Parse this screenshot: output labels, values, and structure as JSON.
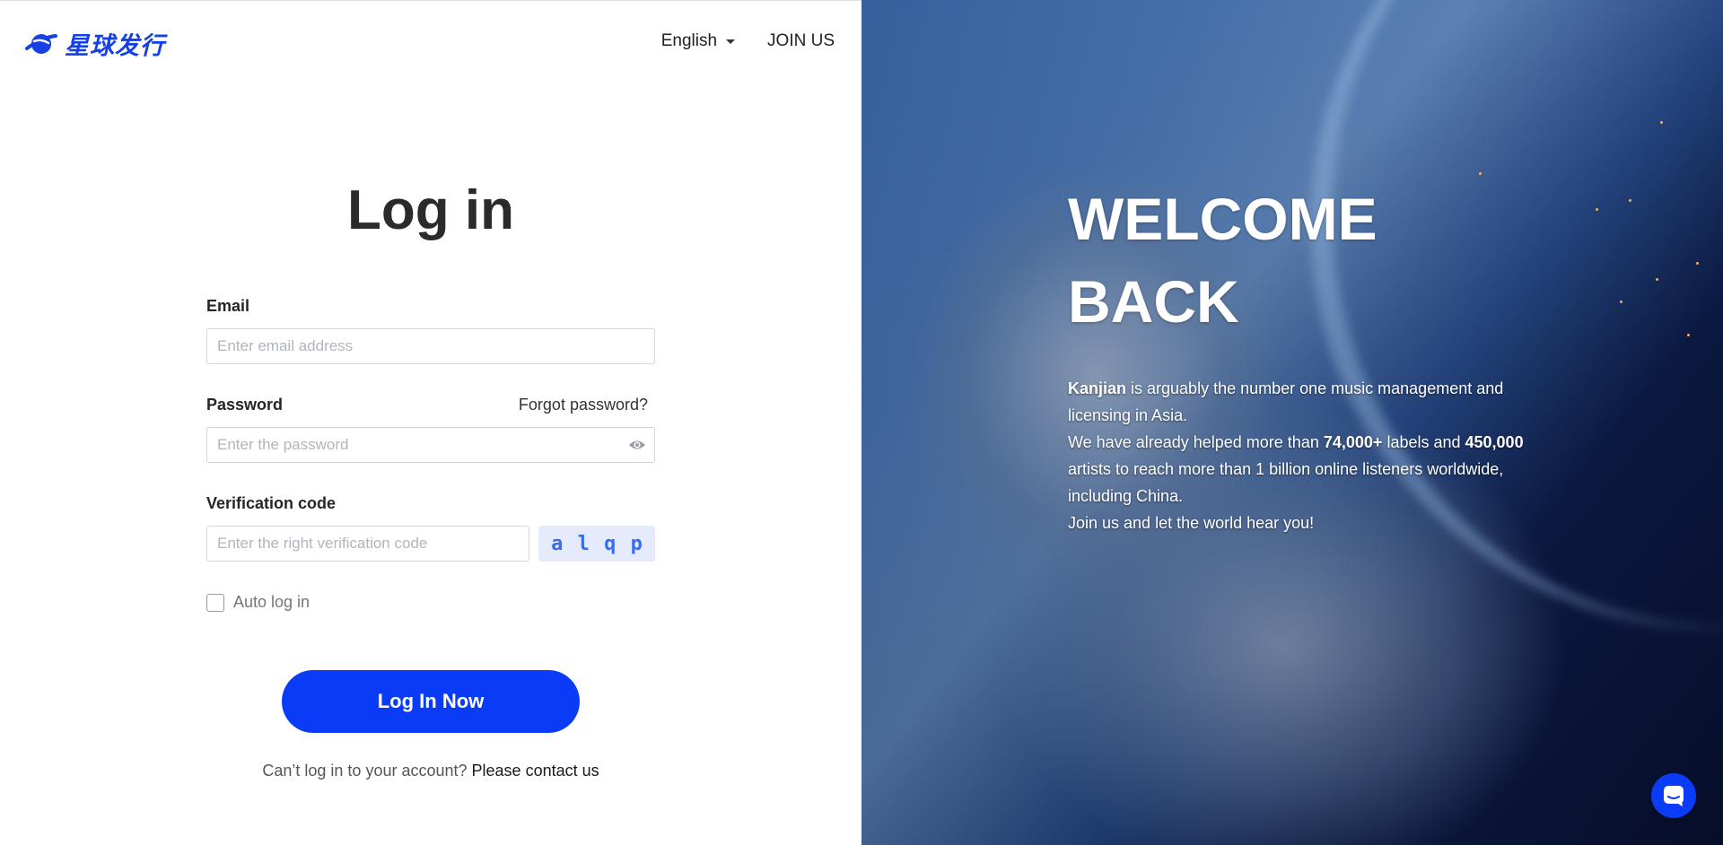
{
  "brand": {
    "logo_text": "星球发行",
    "accent": "#0a3cf7"
  },
  "nav": {
    "language": "English",
    "join": "JOIN US"
  },
  "login": {
    "title": "Log in",
    "email_label": "Email",
    "email_placeholder": "Enter email address",
    "password_label": "Password",
    "forgot": "Forgot password?",
    "password_placeholder": "Enter the password",
    "code_label": "Verification code",
    "code_placeholder": "Enter the right verification code",
    "captcha_chars": [
      "a",
      "l",
      "q",
      "p"
    ],
    "auto_login": "Auto log in",
    "submit": "Log In Now",
    "cant_login": "Can’t log in to your account?",
    "contact": "Please contact us"
  },
  "welcome": {
    "line1": "WELCOME",
    "line2": "BACK",
    "kanjian": "Kanjian",
    "desc_1": " is arguably the number one music management and licensing in Asia.",
    "desc_2a": "We have already helped more than ",
    "labels_count": "74,000+",
    "desc_2b": " labels and ",
    "artists_count": "450,000",
    "desc_2c": " artists to reach more than 1 billion online listeners worldwide, including China.",
    "desc_3": "Join us and let the world hear you!"
  },
  "icons": {
    "eye": "eye-icon",
    "chat": "chat-icon",
    "logo": "planet-logo-icon",
    "caret": "caret-down-icon"
  }
}
